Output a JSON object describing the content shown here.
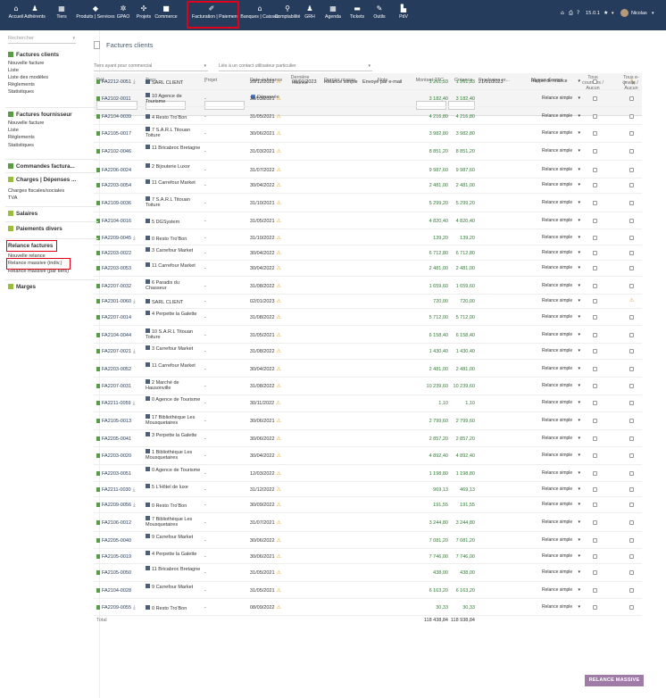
{
  "topbar": {
    "menus": [
      {
        "label": "Accueil",
        "icon": "home-icon",
        "glyph": "⌂"
      },
      {
        "label": "Adhérents",
        "icon": "user-icon",
        "glyph": "♟"
      },
      {
        "label": "Tiers",
        "icon": "building-icon",
        "glyph": "▦"
      },
      {
        "label": "Produits | Services",
        "icon": "cube-icon",
        "glyph": "◆"
      },
      {
        "label": "GPAO",
        "icon": "cogs-icon",
        "glyph": "✲"
      },
      {
        "label": "Projets",
        "icon": "project-icon",
        "glyph": "✣"
      },
      {
        "label": "Commerce",
        "icon": "briefcase-icon",
        "glyph": "■"
      },
      {
        "label": "Facturation | Paiement",
        "icon": "money-icon",
        "glyph": "✐"
      },
      {
        "label": "Banques | Caisses",
        "icon": "bank-icon",
        "glyph": "⌂"
      },
      {
        "label": "Comptabilité",
        "icon": "search-dollar-icon",
        "glyph": "⚲"
      },
      {
        "label": "GRH",
        "icon": "users-icon",
        "glyph": "♟"
      },
      {
        "label": "Agenda",
        "icon": "calendar-icon",
        "glyph": "▦"
      },
      {
        "label": "Tickets",
        "icon": "ticket-icon",
        "glyph": "▬"
      },
      {
        "label": "Outils",
        "icon": "wrench-icon",
        "glyph": "✎"
      },
      {
        "label": "PdV",
        "icon": "cash-register-icon",
        "glyph": "▙"
      }
    ],
    "version": "15.0.1",
    "user": "Nicolas",
    "right_icons": [
      "home-icon",
      "printer-icon",
      "help-icon",
      "star-icon",
      "avatar"
    ]
  },
  "sidebar": {
    "search_placeholder": "Rechercher",
    "sections": [
      {
        "title": "Factures clients",
        "color": "#5a9b45",
        "items": [
          "Nouvelle facture",
          "Liste",
          "Liste des modèles",
          "Règlements",
          "Statistiques"
        ]
      },
      {
        "title": "Factures fournisseur",
        "color": "#5a9b45",
        "items": [
          "Nouvelle facture",
          "Liste",
          "Règlements",
          "Statistiques"
        ]
      },
      {
        "title": "Commandes factura...",
        "color": "#5a9b45",
        "items": []
      },
      {
        "title": "Charges | Dépenses ...",
        "color": "#9bbd3c",
        "items": [
          "Charges fiscales/sociales",
          "TVA"
        ]
      },
      {
        "title": "Salaires",
        "color": "#9bbd3c",
        "items": []
      },
      {
        "title": "Paiements divers",
        "color": "#9bbd3c",
        "items": []
      },
      {
        "title": "Relance factures",
        "color": "",
        "items": [
          "Nouvelle relance",
          "Relance massive (indiv.)",
          "Relance massive (par tiers)"
        ]
      },
      {
        "title": "Marges",
        "color": "#9bbd3c",
        "items": []
      }
    ]
  },
  "page": {
    "title": "Factures clients",
    "filter_commercial_placeholder": "Tiers ayant pour commercial",
    "filter_contact_placeholder": "Liés à un contact utilisateur particulier",
    "overdue_label": "Dépassée",
    "mass_button": "RELANCE MASSIVE",
    "total_label": "Total"
  },
  "table": {
    "headers": {
      "ref": "Réf.",
      "tiers": "Tiers",
      "projet": "Projet",
      "echeance": "Date échéance",
      "derniere": "Dernière relance",
      "niveau": "Dernier niveau",
      "note": "Note",
      "ttc": "Montant TTC",
      "creance": "Créance",
      "prochaine": "Prochaine re...",
      "niveau_envoi": "Niveau d'envoi",
      "courriers": "Tous courriers / Aucun",
      "emails": "Tous e-mails / Aucun"
    },
    "rows": [
      {
        "ref": "FA2212-0051",
        "rw": true,
        "tiers": "SARL CLIENT",
        "projet": "-",
        "ech": "20/12/2022",
        "der": "06/01/2023",
        "niv": "Relance simple",
        "note": "Envoyé par e-mail",
        "ttc": "1 261,93",
        "cre": "1 261,93",
        "pro": "21/01/2023",
        "env": "Rappel de relance",
        "mw": true
      },
      {
        "ref": "FA2102-0011",
        "tiers": "10 Agence de Tourisme",
        "projet": "-",
        "ech": "31/03/2021",
        "ttc": "3 182,40",
        "cre": "3 182,40",
        "env": "Relance simple"
      },
      {
        "ref": "FA2104-0039",
        "tiers": "4 Resto Tro'Bon",
        "projet": "-",
        "ech": "31/05/2021",
        "ttc": "4 216,80",
        "cre": "4 216,80",
        "env": "Relance simple"
      },
      {
        "ref": "FA2105-0017",
        "tiers": "7 S.A.R.L Titouan Toiture",
        "projet": "-",
        "ech": "30/06/2021",
        "ttc": "3 982,80",
        "cre": "3 982,80",
        "env": "Relance simple"
      },
      {
        "ref": "FA2102-0046",
        "tiers": "11 Bricabroc Bretagne",
        "projet": "-",
        "ech": "31/03/2021",
        "ttc": "8 851,20",
        "cre": "8 851,20",
        "env": "Relance simple"
      },
      {
        "ref": "FA2206-0024",
        "tiers": "2 Bijouterie Luxor",
        "projet": "-",
        "ech": "31/07/2022",
        "ttc": "9 987,60",
        "cre": "9 987,60",
        "env": "Relance simple"
      },
      {
        "ref": "FA2203-0054",
        "tiers": "11 Carrefour Market",
        "projet": "-",
        "ech": "30/04/2022",
        "ttc": "2 481,00",
        "cre": "2 481,00",
        "env": "Relance simple"
      },
      {
        "ref": "FA2109-0036",
        "tiers": "7 S.A.R.L Titouan Toiture",
        "projet": "-",
        "ech": "31/10/2021",
        "ttc": "5 299,20",
        "cre": "5 299,20",
        "env": "Relance simple"
      },
      {
        "ref": "FA2104-0016",
        "tiers": "5 DGSystem",
        "projet": "-",
        "ech": "31/05/2021",
        "ttc": "4 820,40",
        "cre": "4 820,40",
        "env": "Relance simple"
      },
      {
        "ref": "FA2209-0045",
        "rw": true,
        "tiers": "0 Resto Tro'Bon",
        "projet": "-",
        "ech": "31/10/2022",
        "ttc": "139,20",
        "cre": "139,20",
        "env": "Relance simple"
      },
      {
        "ref": "FA2203-0022",
        "tiers": "3 Carrefour Market",
        "projet": "-",
        "ech": "30/04/2022",
        "ttc": "6 712,80",
        "cre": "6 712,80",
        "env": "Relance simple"
      },
      {
        "ref": "FA2203-0053",
        "tiers": "11 Carrefour Market",
        "projet": "-",
        "ech": "30/04/2022",
        "ttc": "2 481,00",
        "cre": "2 481,00",
        "env": "Relance simple"
      },
      {
        "ref": "FA2207-0032",
        "tiers": "6 Paradis du Chasseur",
        "projet": "-",
        "ech": "31/08/2022",
        "ttc": "1 659,60",
        "cre": "1 659,60",
        "env": "Relance simple"
      },
      {
        "ref": "FA2301-0060",
        "rw": true,
        "tiers": "SARL CLIENT",
        "projet": "-",
        "ech": "02/01/2023",
        "ttc": "720,00",
        "cre": "720,00",
        "env": "Relance simple",
        "mw": true
      },
      {
        "ref": "FA2207-0014",
        "tiers": "4 Perpette la Galette",
        "projet": "-",
        "ech": "31/08/2022",
        "ttc": "5 712,00",
        "cre": "5 712,00",
        "env": "Relance simple"
      },
      {
        "ref": "FA2104-0044",
        "tiers": "10 S.A.R.L Titouan Toiture",
        "projet": "-",
        "ech": "31/05/2021",
        "ttc": "6 158,40",
        "cre": "6 158,40",
        "env": "Relance simple"
      },
      {
        "ref": "FA2207-0021",
        "rw": true,
        "tiers": "3 Carrefour Market",
        "projet": "-",
        "ech": "31/08/2022",
        "ttc": "1 430,40",
        "cre": "1 430,40",
        "env": "Relance simple"
      },
      {
        "ref": "FA2203-0052",
        "tiers": "11 Carrefour Market",
        "projet": "-",
        "ech": "30/04/2022",
        "ttc": "2 481,00",
        "cre": "2 481,00",
        "env": "Relance simple"
      },
      {
        "ref": "FA2207-0031",
        "tiers": "2 Marché de Hausonville",
        "projet": "-",
        "ech": "31/08/2022",
        "ttc": "10 239,60",
        "cre": "10 239,60",
        "env": "Relance simple"
      },
      {
        "ref": "FA2211-0059",
        "rw": true,
        "tiers": "0 Agence de Tourisme",
        "projet": "-",
        "ech": "30/11/2022",
        "ttc": "1,10",
        "cre": "1,10",
        "env": "Relance simple"
      },
      {
        "ref": "FA2105-0013",
        "tiers": "17 Bibliothèque Les Mousquetaires",
        "projet": "-",
        "ech": "30/06/2021",
        "ttc": "2 799,60",
        "cre": "2 799,60",
        "env": "Relance simple"
      },
      {
        "ref": "FA2205-0041",
        "tiers": "3 Perpette la Galette",
        "projet": "-",
        "ech": "30/06/2022",
        "ttc": "2 857,20",
        "cre": "2 857,20",
        "env": "Relance simple"
      },
      {
        "ref": "FA2203-0020",
        "tiers": "1 Bibliothèque Les Mousquetaires",
        "projet": "-",
        "ech": "30/04/2022",
        "ttc": "4 892,40",
        "cre": "4 892,40",
        "env": "Relance simple"
      },
      {
        "ref": "FA2203-0051",
        "tiers": "0 Agence de Tourisme",
        "projet": "-",
        "ech": "12/03/2022",
        "ttc": "1 198,80",
        "cre": "1 198,80",
        "env": "Relance simple"
      },
      {
        "ref": "FA2211-0030",
        "rw": true,
        "tiers": "5 L'Hôtel de luxe",
        "projet": "-",
        "ech": "31/12/2022",
        "ttc": "969,13",
        "cre": "469,13",
        "env": "Relance simple"
      },
      {
        "ref": "FA2209-0056",
        "rw": true,
        "tiers": "0 Resto Tro'Bon",
        "projet": "-",
        "ech": "30/09/2022",
        "ttc": "191,55",
        "cre": "191,55",
        "env": "Relance simple"
      },
      {
        "ref": "FA2106-0012",
        "tiers": "7 Bibliothèque Les Mousquetaires",
        "projet": "-",
        "ech": "31/07/2021",
        "ttc": "3 244,80",
        "cre": "3 244,80",
        "env": "Relance simple"
      },
      {
        "ref": "FA2205-0040",
        "tiers": "9 Carrefour Market",
        "projet": "-",
        "ech": "30/06/2022",
        "ttc": "7 081,20",
        "cre": "7 081,20",
        "env": "Relance simple"
      },
      {
        "ref": "FA2105-0019",
        "tiers": "4 Perpette la Galette",
        "projet": "-",
        "ech": "30/06/2021",
        "ttc": "7 746,00",
        "cre": "7 746,00",
        "env": "Relance simple"
      },
      {
        "ref": "FA2105-0050",
        "tiers": "11 Bricabroc Bretagne",
        "projet": "-",
        "ech": "31/05/2021",
        "ttc": "438,00",
        "cre": "438,00",
        "env": "Relance simple"
      },
      {
        "ref": "FA2104-0028",
        "tiers": "9 Carrefour Market",
        "projet": "-",
        "ech": "31/05/2021",
        "ttc": "6 163,20",
        "cre": "6 163,20",
        "env": "Relance simple"
      },
      {
        "ref": "FA2209-0055",
        "rw": true,
        "tiers": "0 Resto Tro'Bon",
        "projet": "-",
        "ech": "08/09/2022",
        "ttc": "30,33",
        "cre": "30,33",
        "env": "Relance simple"
      }
    ],
    "total_ttc": "118 438,84",
    "total_creance": "118 938,84"
  }
}
